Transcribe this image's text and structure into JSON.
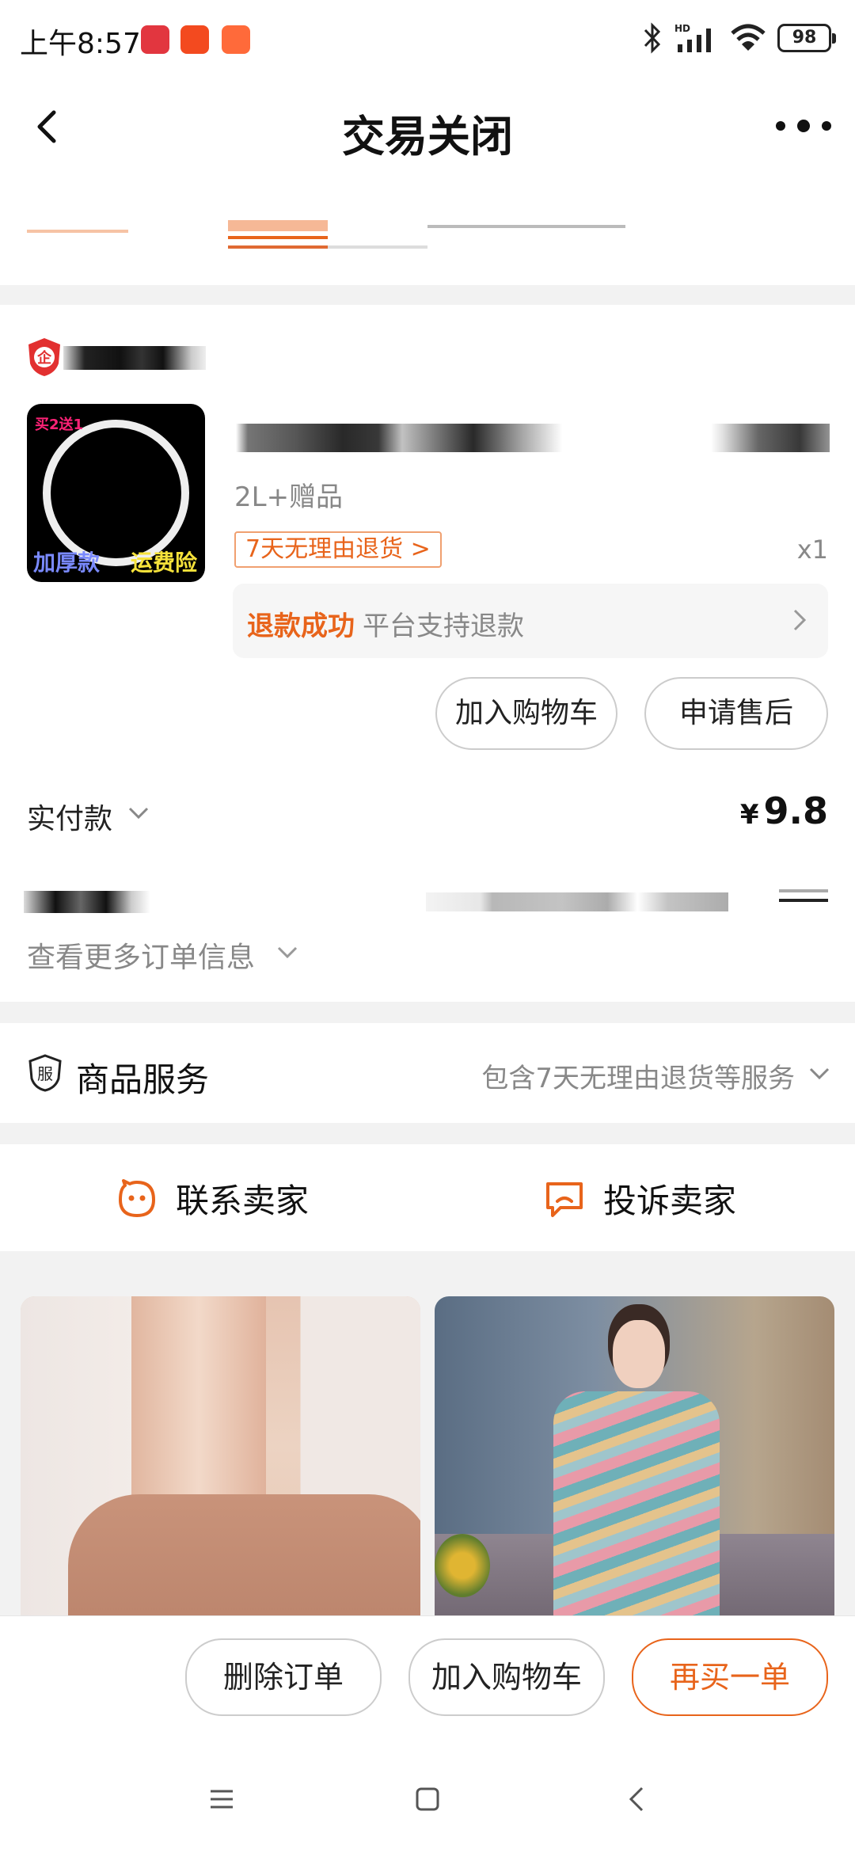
{
  "status_bar": {
    "time": "上午8:57",
    "battery": "98",
    "network": "HD"
  },
  "nav": {
    "title": "交易关闭"
  },
  "order": {
    "product_spec": "2L+赠品",
    "thumb_text_top": "买2送1",
    "thumb_text_left": "加厚款",
    "thumb_text_right": "运费险",
    "return_tag": "7天无理由退货 >",
    "quantity": "x1",
    "refund_status": "退款成功",
    "refund_desc": "平台支持退款",
    "add_to_cart": "加入购物车",
    "after_sale": "申请售后",
    "paid_label": "实付款",
    "paid_currency": "¥",
    "paid_amount": "9.8",
    "more_info": "查看更多订单信息"
  },
  "service": {
    "icon_char": "服",
    "label": "商品服务",
    "value": "包含7天无理由退货等服务"
  },
  "contact": {
    "contact_seller": "联系卖家",
    "complain_seller": "投诉卖家"
  },
  "actions": {
    "delete_order": "删除订单",
    "add_to_cart": "加入购物车",
    "buy_again": "再买一单"
  },
  "colors": {
    "accent": "#e8641b",
    "muted": "#888888",
    "background": "#f2f2f2"
  }
}
